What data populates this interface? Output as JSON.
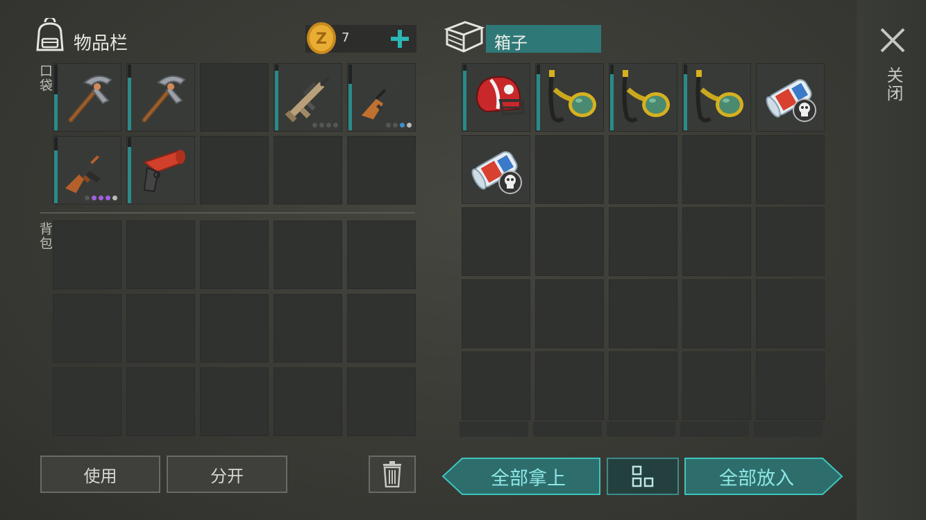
{
  "inventory": {
    "title": "物品栏",
    "coins": "7",
    "pocket_label": "口袋",
    "backpack_label": "背包"
  },
  "box": {
    "title": "箱子"
  },
  "close_label": "关闭",
  "buttons": {
    "use": "使用",
    "split": "分开",
    "take_all": "全部拿上",
    "put_all": "全部放入"
  },
  "pocket_items": [
    {
      "name": "pickaxe",
      "durability": 0.55,
      "dots": []
    },
    {
      "name": "pickaxe",
      "durability": 0.8,
      "dots": []
    },
    {
      "name": "empty"
    },
    {
      "name": "assault-rifle-scar",
      "durability": 0.9,
      "dots": [
        "#555",
        "#555",
        "#555",
        "#555"
      ]
    },
    {
      "name": "hunting-rifle",
      "durability": 0.7,
      "dots": [
        "#555",
        "#555",
        "#3a8fd0",
        "#bbb"
      ]
    },
    {
      "name": "ak47",
      "durability": 0.8,
      "dots": [
        "#555",
        "#a060e0",
        "#a060e0",
        "#a060e0",
        "#bbb"
      ]
    },
    {
      "name": "flare-gun",
      "durability": 0.85,
      "dots": []
    }
  ],
  "box_items": [
    {
      "name": "football-helmet",
      "durability": 0.9
    },
    {
      "name": "snorkel-mask",
      "durability": 0.85
    },
    {
      "name": "snorkel-mask",
      "durability": 0.85
    },
    {
      "name": "snorkel-mask",
      "durability": 0.85
    },
    {
      "name": "magazine-scroll"
    },
    {
      "name": "magazine-scroll"
    }
  ]
}
